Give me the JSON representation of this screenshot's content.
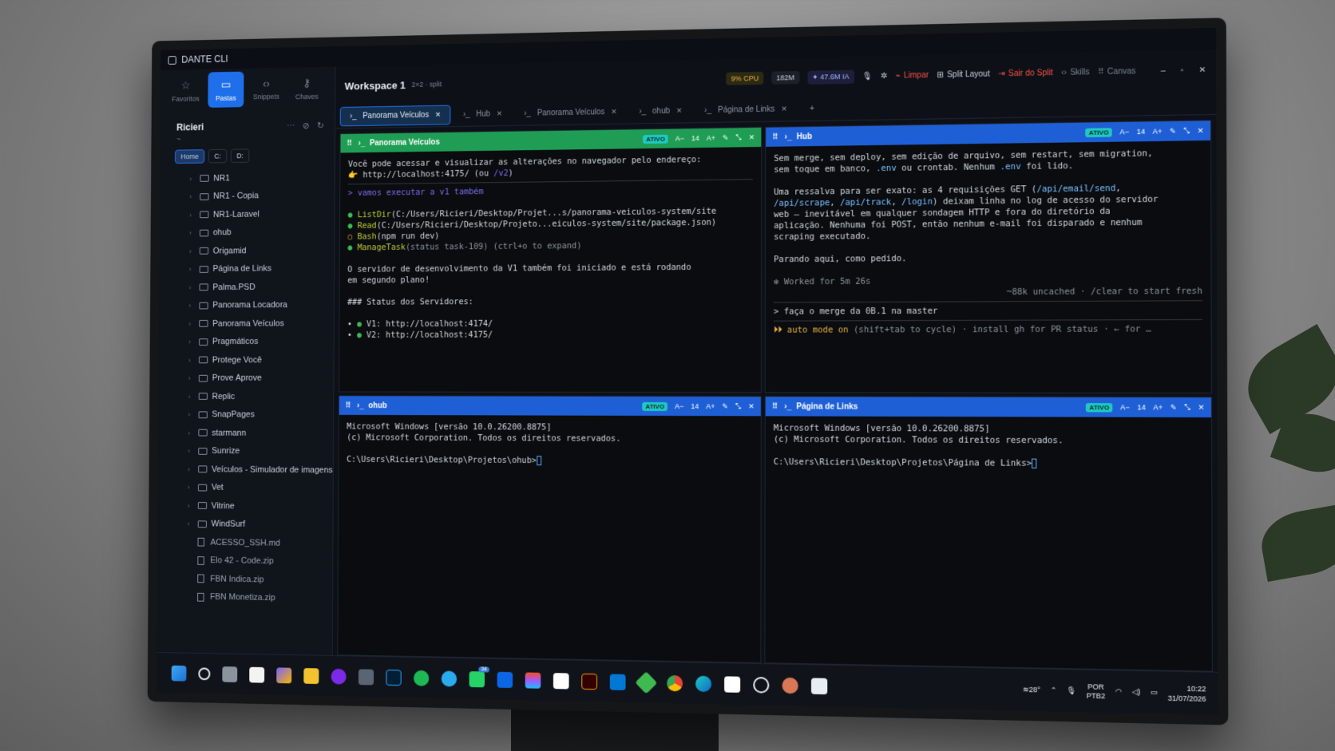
{
  "app": {
    "title": "DANTE CLI"
  },
  "sidebar": {
    "tabs": [
      {
        "label": "Favoritos",
        "icon": "star-icon"
      },
      {
        "label": "Pastas",
        "icon": "folder-icon"
      },
      {
        "label": "Snippets",
        "icon": "code-icon"
      },
      {
        "label": "Chaves",
        "icon": "key-icon"
      }
    ],
    "title": "Ricieri",
    "subtitle": "~",
    "drives": [
      "Home",
      "C:",
      "D:"
    ],
    "folders": [
      "NR1",
      "NR1 - Copia",
      "NR1-Laravel",
      "ohub",
      "Origamid",
      "Página de Links",
      "Palma.PSD",
      "Panorama Locadora",
      "Panorama Veículos",
      "Pragmáticos",
      "Protege Você",
      "Prove Aprove",
      "Replic",
      "SnapPages",
      "starmann",
      "Sunrize",
      "Veículos - Simulador de imagens",
      "Vet",
      "Vitrine",
      "WindSurf"
    ],
    "files": [
      "ACESSO_SSH.md",
      "Elo 42 - Code.zip",
      "FBN Indica.zip",
      "FBN Monetiza.zip"
    ]
  },
  "workspace": {
    "title": "Workspace 1",
    "subtitle": "2×2 · split",
    "cpu": "9% CPU",
    "mem": "182M",
    "ia": "47.6M IA",
    "clear": "Limpar",
    "split_layout": "Split Layout",
    "exit_split": "Sair do Split",
    "skills": "Skills",
    "canvas": "Canvas"
  },
  "tabs": [
    "Panorama Veículos",
    "Hub",
    "Panorama Veículos",
    "ohub",
    "Página de Links"
  ],
  "panes": {
    "pv": {
      "title": "Panorama Veículos",
      "badge": "ATIVO",
      "font_size": "14",
      "l1": "Você pode acessar e visualizar as alterações no navegador pelo endereço:",
      "l2_pre": "👉 http://localhost:4175/ (ou ",
      "l2_link": "/v2",
      "l2_post": ")",
      "comment": "> vamos executar a v1 também",
      "t1_name": "ListDir",
      "t1_arg": "(C:/Users/Ricieri/Desktop/Projet...s/panorama-veiculos-system/site",
      "t2_name": "Read",
      "t2_arg": "(C:/Users/Ricieri/Desktop/Projeto...eiculos-system/site/package.json)",
      "t3_name": "Bash",
      "t3_arg": "(npm run dev)",
      "t4_name": "ManageTask",
      "t4_arg": "(status task-109) (ctrl+o to expand)",
      "msg": "O servidor de desenvolvimento da V1 também foi iniciado e está rodando\nem segundo plano!",
      "status_title": "### Status dos Servidores:",
      "v1": "V1: http://localhost:4174/",
      "v2": "V2: http://localhost:4175/"
    },
    "hub": {
      "title": "Hub",
      "badge": "ATIVO",
      "font_size": "14",
      "p1_a": "Sem merge, sem deploy, sem edição de arquivo, sem restart, sem migration,\nsem toque em banco, ",
      "p1_env": ".env",
      "p1_b": " ou crontab. Nenhum ",
      "p1_env2": ".env",
      "p1_c": " foi lido.",
      "p2_a": "Uma ressalva para ser exato: as 4 requisições GET (",
      "p2_l1": "/api/email/send",
      "p2_b": ",\n",
      "p2_l2": "/api/scrape",
      "p2_c": ", ",
      "p2_l3": "/api/track",
      "p2_d": ", ",
      "p2_l4": "/login",
      "p2_e": ") deixam linha no log de acesso do servidor\nweb — inevitável em qualquer sondagem HTTP e fora do diretório da\naplicação. Nenhuma foi POST, então nenhum e-mail foi disparado e nenhum\nscraping executado.",
      "p3": "Parando aqui, como pedido.",
      "worked": "✻ Worked for 5m 26s",
      "cache": "~88k uncached · /clear to start fresh",
      "prompt_mark": ">",
      "prompt": " faça o merge da 0B.1 na master",
      "auto_mark": "⏵⏵",
      "auto": " auto mode on",
      "auto_rest": " (shift+tab to cycle) · install gh for PR status · ← for …"
    },
    "ohub": {
      "title": "ohub",
      "badge": "ATIVO",
      "font_size": "14",
      "l1": "Microsoft Windows [versão 10.0.26200.8875]",
      "l2": "(c) Microsoft Corporation. Todos os direitos reservados.",
      "prompt": "C:\\Users\\Ricieri\\Desktop\\Projetos\\ohub>"
    },
    "links": {
      "title": "Página de Links",
      "badge": "ATIVO",
      "font_size": "14",
      "l1": "Microsoft Windows [versão 10.0.26200.8875]",
      "l2": "(c) Microsoft Corporation. Todos os direitos reservados.",
      "prompt": "C:\\Users\\Ricieri\\Desktop\\Projetos\\Página de Links>"
    }
  },
  "taskbar": {
    "whatsapp_badge": "34",
    "weather": "28°",
    "lang1": "POR",
    "lang2": "PTB2",
    "time": "10:22",
    "date": "31/07/2026"
  }
}
